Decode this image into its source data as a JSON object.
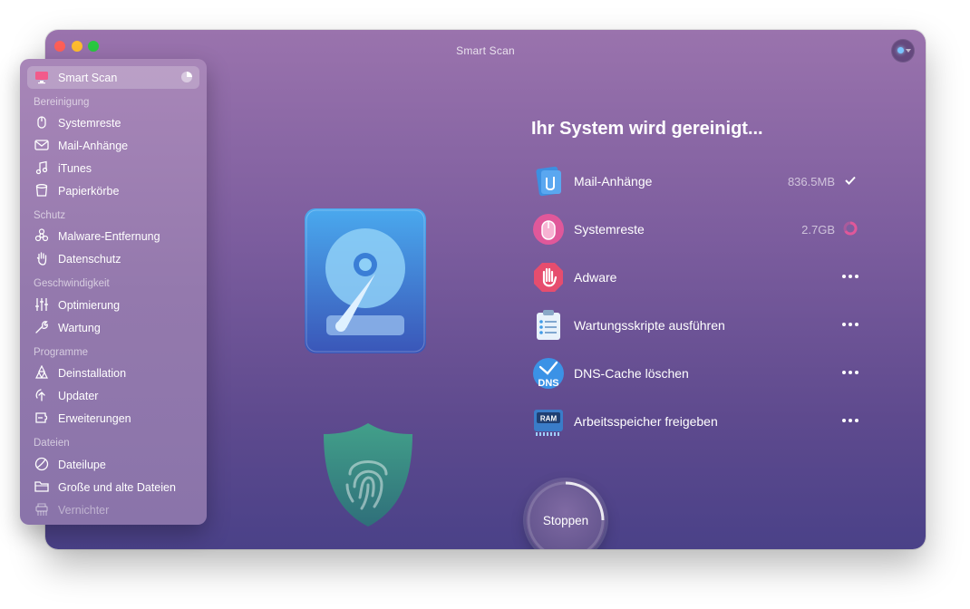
{
  "window": {
    "title": "Smart Scan"
  },
  "sidebar": {
    "active": {
      "label": "Smart Scan",
      "icon": "monitor-icon"
    },
    "sections": [
      {
        "title": "Bereinigung",
        "items": [
          {
            "label": "Systemreste",
            "icon": "system-junk-icon"
          },
          {
            "label": "Mail-Anhänge",
            "icon": "envelope-icon"
          },
          {
            "label": "iTunes",
            "icon": "music-note-icon"
          },
          {
            "label": "Papierkörbe",
            "icon": "trash-bin-icon"
          }
        ]
      },
      {
        "title": "Schutz",
        "items": [
          {
            "label": "Malware-Entfernung",
            "icon": "biohazard-icon"
          },
          {
            "label": "Datenschutz",
            "icon": "hand-icon"
          }
        ]
      },
      {
        "title": "Geschwindigkeit",
        "items": [
          {
            "label": "Optimierung",
            "icon": "sliders-icon"
          },
          {
            "label": "Wartung",
            "icon": "wrench-icon"
          }
        ]
      },
      {
        "title": "Programme",
        "items": [
          {
            "label": "Deinstallation",
            "icon": "uninstaller-icon"
          },
          {
            "label": "Updater",
            "icon": "updater-icon"
          },
          {
            "label": "Erweiterungen",
            "icon": "extensions-icon"
          }
        ]
      },
      {
        "title": "Dateien",
        "items": [
          {
            "label": "Dateilupe",
            "icon": "lens-icon"
          },
          {
            "label": "Große und alte Dateien",
            "icon": "folder-icon"
          },
          {
            "label": "Vernichter",
            "icon": "shredder-icon"
          }
        ]
      }
    ]
  },
  "main": {
    "headline": "Ihr System wird gereinigt...",
    "tasks": [
      {
        "name": "Mail-Anhänge",
        "size": "836.5MB",
        "status": "done",
        "icon": "mail-attachments-icon"
      },
      {
        "name": "Systemreste",
        "size": "2.7GB",
        "status": "in-progress",
        "icon": "system-junk-icon"
      },
      {
        "name": "Adware",
        "size": "",
        "status": "pending",
        "icon": "adware-hand-icon"
      },
      {
        "name": "Wartungsskripte ausführen",
        "size": "",
        "status": "pending",
        "icon": "clipboard-icon"
      },
      {
        "name": "DNS-Cache löschen",
        "size": "",
        "status": "pending",
        "icon": "dns-icon"
      },
      {
        "name": "Arbeitsspeicher freigeben",
        "size": "",
        "status": "pending",
        "icon": "ram-icon"
      }
    ],
    "ram_icon_text": "RAM",
    "dns_icon_text": "DNS",
    "stop_button": "Stoppen"
  },
  "colors": {
    "window_top": "#9a73ad",
    "window_bottom": "#4a4188",
    "sidebar": "#9479ad",
    "progress_pink": "#e0589a",
    "shield_green": "#3e8a7a"
  }
}
